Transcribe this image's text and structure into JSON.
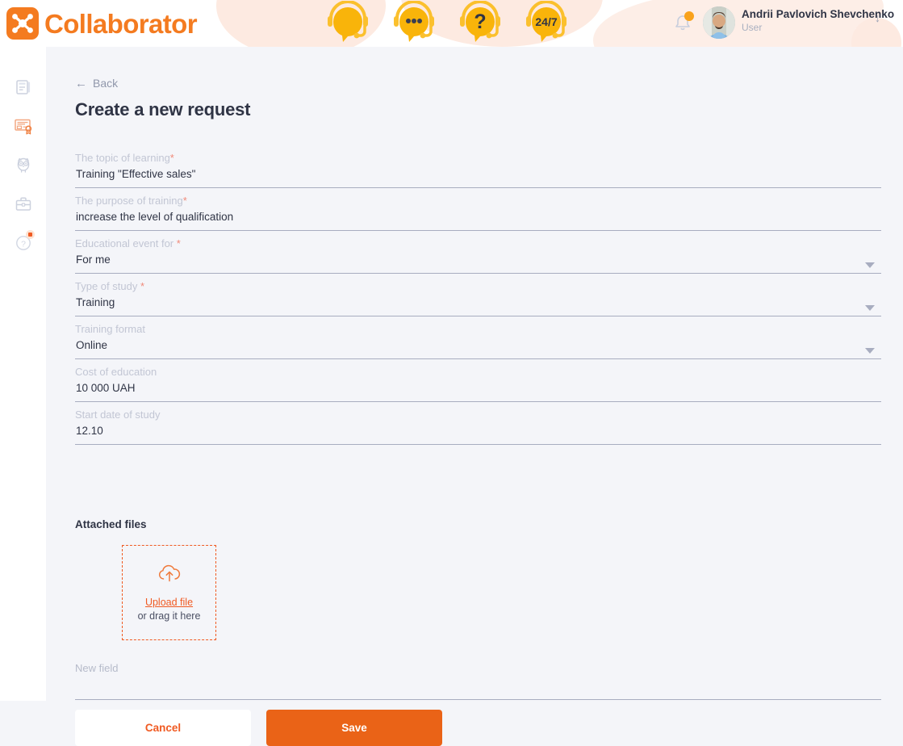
{
  "header": {
    "brand": "Collaborator",
    "logo_icon": "network-nodes-icon",
    "support_icons": [
      {
        "name": "support-chat-headset-icon",
        "label": ""
      },
      {
        "name": "support-chat-dots-icon",
        "label": "•••"
      },
      {
        "name": "support-chat-help-icon",
        "label": "?"
      },
      {
        "name": "support-chat-247-icon",
        "label": "24/7"
      }
    ],
    "notification_icon": "bell-icon",
    "has_notification": true,
    "avatar_icon": "user-avatar",
    "user_name": "Andrii Pavlovich Shevchenko",
    "user_role": "User",
    "user_caret": "↓"
  },
  "sidebar": {
    "items": [
      {
        "name": "sidebar-item-news",
        "icon": "document-list-icon",
        "active": false,
        "badge": false
      },
      {
        "name": "sidebar-item-certificates",
        "icon": "certificate-icon",
        "active": true,
        "badge": false
      },
      {
        "name": "sidebar-item-knowledge",
        "icon": "owl-icon",
        "active": false,
        "badge": false
      },
      {
        "name": "sidebar-item-portfolio",
        "icon": "briefcase-icon",
        "active": false,
        "badge": false
      },
      {
        "name": "sidebar-item-help",
        "icon": "question-circle-icon",
        "active": false,
        "badge": true
      }
    ]
  },
  "main": {
    "back_label": "Back",
    "back_arrow": "←",
    "title": "Create a new request",
    "fields": [
      {
        "label": "The topic of learning",
        "required": true,
        "required_space": false,
        "value": "Training \"Effective sales\"",
        "type": "text"
      },
      {
        "label": "The purpose of training",
        "required": true,
        "required_space": false,
        "value": "increase the level of qualification",
        "type": "text"
      },
      {
        "label": "Educational event for",
        "required": true,
        "required_space": true,
        "value": "For me",
        "type": "select"
      },
      {
        "label": "Type of study",
        "required": true,
        "required_space": true,
        "value": "Training",
        "type": "select"
      },
      {
        "label": "Training format",
        "required": false,
        "required_space": false,
        "value": "Online",
        "type": "select"
      },
      {
        "label": "Cost of education",
        "required": false,
        "required_space": false,
        "value": "10 000 UAH",
        "type": "text"
      },
      {
        "label": "Start date of study",
        "required": false,
        "required_space": false,
        "value": "12.10",
        "type": "text"
      }
    ],
    "attached_files": {
      "heading": "Attached files",
      "upload_icon": "cloud-upload-icon",
      "upload_link": "Upload file",
      "upload_hint": "or drag it here"
    },
    "new_field": {
      "label": "New field",
      "value": ""
    },
    "buttons": {
      "cancel": "Cancel",
      "save": "Save"
    }
  },
  "colors": {
    "brand_orange": "#f47b20",
    "accent_orange": "#f05a22",
    "save_orange": "#ea6317",
    "support_yellow": "#f9b40a",
    "page_bg": "#f4f5f9",
    "text_dark": "#2f3445",
    "label_grey": "#c2c6d4",
    "required_red": "#f08a7a"
  }
}
